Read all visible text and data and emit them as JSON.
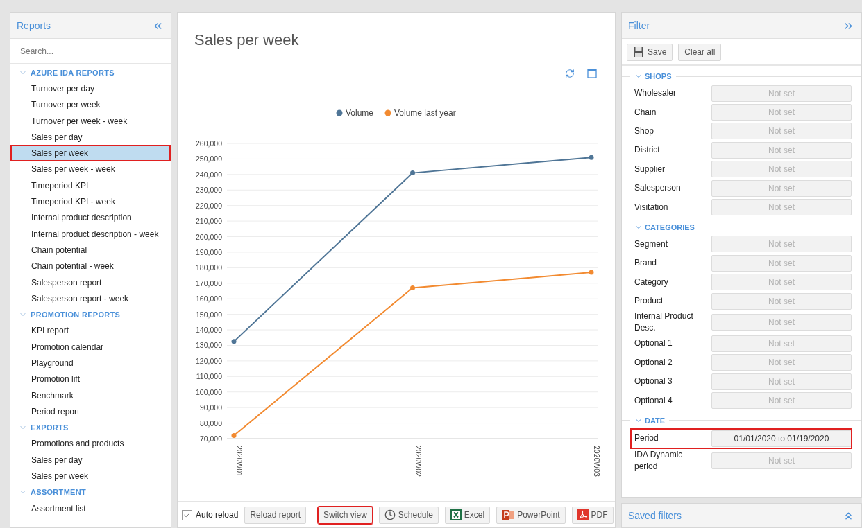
{
  "sidebar": {
    "title": "Reports",
    "search": {
      "placeholder": "Search..."
    },
    "groups": [
      {
        "label": "AZURE IDA REPORTS",
        "expanded": true,
        "items": [
          {
            "label": "Turnover per day",
            "selected": false
          },
          {
            "label": "Turnover per week",
            "selected": false
          },
          {
            "label": "Turnover per week - week",
            "selected": false
          },
          {
            "label": "Sales per day",
            "selected": false
          },
          {
            "label": "Sales per week",
            "selected": true
          },
          {
            "label": "Sales per week - week",
            "selected": false
          },
          {
            "label": "Timeperiod KPI",
            "selected": false
          },
          {
            "label": "Timeperiod KPI - week",
            "selected": false
          },
          {
            "label": "Internal product description",
            "selected": false
          },
          {
            "label": "Internal product description - week",
            "selected": false
          },
          {
            "label": "Chain potential",
            "selected": false
          },
          {
            "label": "Chain potential - week",
            "selected": false
          },
          {
            "label": "Salesperson report",
            "selected": false
          },
          {
            "label": "Salesperson report - week",
            "selected": false
          }
        ]
      },
      {
        "label": "PROMOTION REPORTS",
        "expanded": true,
        "items": [
          {
            "label": "KPI report",
            "selected": false
          },
          {
            "label": "Promotion calendar",
            "selected": false
          },
          {
            "label": "Playground",
            "selected": false
          },
          {
            "label": "Promotion lift",
            "selected": false
          },
          {
            "label": "Benchmark",
            "selected": false
          },
          {
            "label": "Period report",
            "selected": false
          }
        ]
      },
      {
        "label": "EXPORTS",
        "expanded": true,
        "items": [
          {
            "label": "Promotions and products",
            "selected": false
          },
          {
            "label": "Sales per day",
            "selected": false
          },
          {
            "label": "Sales per week",
            "selected": false
          }
        ]
      },
      {
        "label": "ASSORTMENT",
        "expanded": true,
        "items": [
          {
            "label": "Assortment list",
            "selected": false
          }
        ]
      }
    ]
  },
  "report": {
    "title": "Sales per week",
    "chart_data": {
      "type": "line",
      "grid": true,
      "legend": true,
      "categories": [
        "2020W01",
        "2020W02",
        "2020W03"
      ],
      "series": [
        {
          "name": "Volume",
          "color": "#4f7596",
          "marker": "circle",
          "values": [
            132500,
            241000,
            251000
          ]
        },
        {
          "name": "Volume last year",
          "color": "#f28a30",
          "marker": "circle",
          "values": [
            72000,
            167000,
            177000
          ]
        }
      ],
      "ylim": [
        70000,
        260000
      ],
      "yticks": [
        {
          "value": 70000,
          "label": "70,000"
        },
        {
          "value": 80000,
          "label": "80,000"
        },
        {
          "value": 90000,
          "label": "90,000"
        },
        {
          "value": 100000,
          "label": "100,000"
        },
        {
          "value": 110000,
          "label": "110,000"
        },
        {
          "value": 120000,
          "label": "120,000"
        },
        {
          "value": 130000,
          "label": "130,000"
        },
        {
          "value": 140000,
          "label": "140,000"
        },
        {
          "value": 150000,
          "label": "150,000"
        },
        {
          "value": 160000,
          "label": "160,000"
        },
        {
          "value": 170000,
          "label": "170,000"
        },
        {
          "value": 180000,
          "label": "180,000"
        },
        {
          "value": 190000,
          "label": "190,000"
        },
        {
          "value": 200000,
          "label": "200,000"
        },
        {
          "value": 210000,
          "label": "210,000"
        },
        {
          "value": 220000,
          "label": "220,000"
        },
        {
          "value": 230000,
          "label": "230,000"
        },
        {
          "value": 240000,
          "label": "240,000"
        },
        {
          "value": 250000,
          "label": "250,000"
        },
        {
          "value": 260000,
          "label": "260,000"
        }
      ]
    },
    "toolbar": {
      "auto_reload": {
        "label": "Auto reload",
        "checked": true
      },
      "buttons": [
        {
          "label": "Reload report",
          "kind": "plain",
          "highlighted": false
        },
        {
          "label": "Switch view",
          "kind": "plain",
          "highlighted": true
        },
        {
          "label": "Schedule",
          "kind": "schedule",
          "highlighted": false
        },
        {
          "label": "Excel",
          "kind": "excel",
          "highlighted": false
        },
        {
          "label": "PowerPoint",
          "kind": "powerpoint",
          "highlighted": false
        },
        {
          "label": "PDF",
          "kind": "pdf",
          "highlighted": false
        }
      ]
    }
  },
  "filter": {
    "title": "Filter",
    "buttons": [
      {
        "label": "Save",
        "kind": "save"
      },
      {
        "label": "Clear all",
        "kind": "plain"
      }
    ],
    "sections": [
      {
        "label": "SHOPS",
        "expanded": true,
        "fields": [
          {
            "label": "Wholesaler",
            "placeholder": "Not set",
            "highlighted": false
          },
          {
            "label": "Chain",
            "placeholder": "Not set",
            "highlighted": false
          },
          {
            "label": "Shop",
            "placeholder": "Not set",
            "highlighted": false
          },
          {
            "label": "District",
            "placeholder": "Not set",
            "highlighted": false
          },
          {
            "label": "Supplier",
            "placeholder": "Not set",
            "highlighted": false
          },
          {
            "label": "Salesperson",
            "placeholder": "Not set",
            "highlighted": false
          },
          {
            "label": "Visitation",
            "placeholder": "Not set",
            "highlighted": false
          }
        ]
      },
      {
        "label": "CATEGORIES",
        "expanded": true,
        "fields": [
          {
            "label": "Segment",
            "placeholder": "Not set",
            "highlighted": false
          },
          {
            "label": "Brand",
            "placeholder": "Not set",
            "highlighted": false
          },
          {
            "label": "Category",
            "placeholder": "Not set",
            "highlighted": false
          },
          {
            "label": "Product",
            "placeholder": "Not set",
            "highlighted": false
          },
          {
            "label": "Internal Product Desc.",
            "placeholder": "Not set",
            "highlighted": false
          },
          {
            "label": "Optional 1",
            "placeholder": "Not set",
            "highlighted": false
          },
          {
            "label": "Optional 2",
            "placeholder": "Not set",
            "highlighted": false
          },
          {
            "label": "Optional 3",
            "placeholder": "Not set",
            "highlighted": false
          },
          {
            "label": "Optional 4",
            "placeholder": "Not set",
            "highlighted": false
          }
        ]
      },
      {
        "label": "DATE",
        "expanded": true,
        "fields": [
          {
            "label": "Period",
            "value": "01/01/2020 to 01/19/2020",
            "highlighted": true
          },
          {
            "label": "IDA Dynamic period",
            "placeholder": "Not set",
            "highlighted": false
          }
        ]
      }
    ]
  },
  "saved_filters": {
    "title": "Saved filters"
  }
}
